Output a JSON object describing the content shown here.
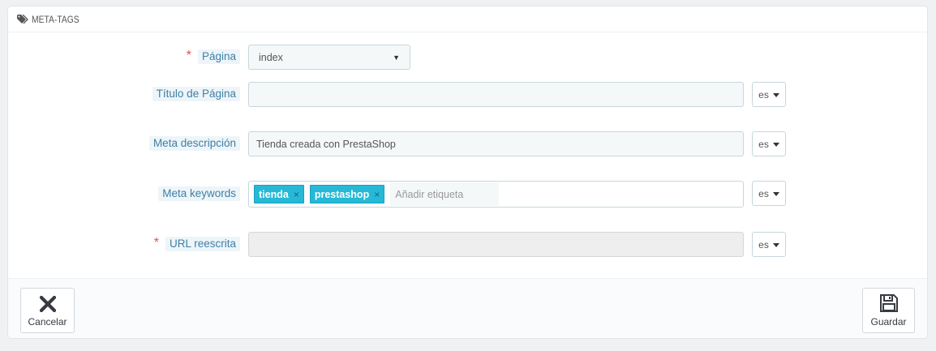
{
  "panel": {
    "title": "META-TAGS"
  },
  "fields": {
    "page": {
      "label": "Página",
      "value": "index",
      "required": true
    },
    "page_title": {
      "label": "Título de Página",
      "value": "",
      "lang": "es"
    },
    "meta_description": {
      "label": "Meta descripción",
      "value": "Tienda creada con PrestaShop",
      "lang": "es"
    },
    "meta_keywords": {
      "label": "Meta keywords",
      "tags": [
        "tienda",
        "prestashop"
      ],
      "tag_remove": "×",
      "placeholder": "Añadir etiqueta",
      "lang": "es"
    },
    "rewritten_url": {
      "label": "URL reescrita",
      "value": "",
      "required": true,
      "lang": "es"
    }
  },
  "required_mark": "*",
  "footer": {
    "cancel_label": "Cancelar",
    "save_label": "Guardar"
  },
  "colors": {
    "tag_bg": "#25b9d7",
    "label_text": "#3f7fa5",
    "required": "#e84b4b"
  }
}
